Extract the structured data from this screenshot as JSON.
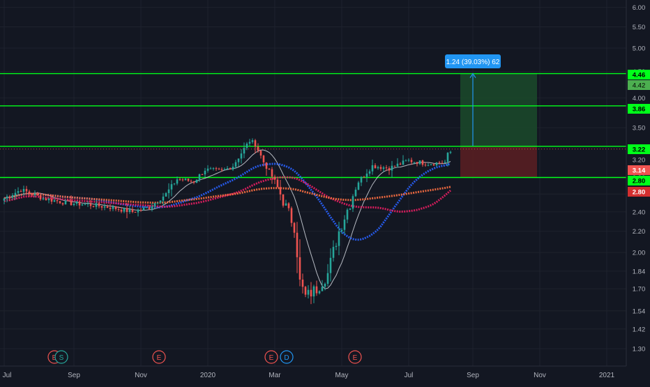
{
  "colors": {
    "background": "#131722",
    "grid": "#1e222d",
    "axis_text": "#b2b5be",
    "up": "#26a69a",
    "down": "#ef5350",
    "level_line": "#00ff1a",
    "profit_zone": "#1b4a2a",
    "loss_zone": "#5c1e22",
    "ma_fast": "#e0e3eb",
    "ma_mid": "#2962ff",
    "ma_slow": "#e91e63",
    "ma_long": "#ff7043",
    "measure": "#2196f3",
    "dotted_line": "#ff5252",
    "event_earnings": "#ef5350",
    "event_dividend": "#2196f3",
    "event_split": "#26a69a"
  },
  "chart_data": {
    "type": "candlestick",
    "x_axis_labels": [
      "Jul",
      "Sep",
      "Nov",
      "2020",
      "Mar",
      "May",
      "Jul",
      "Sep",
      "Nov",
      "2021"
    ],
    "y_axis_labels": [
      "6.00",
      "5.50",
      "5.00",
      "4.50",
      "4.00",
      "3.50",
      "2.80",
      "2.60",
      "2.40",
      "2.20",
      "2.00",
      "1.84",
      "1.70",
      "1.54",
      "1.42",
      "1.30"
    ],
    "y_scale": "log",
    "ylim": [
      1.26,
      6.05
    ],
    "grid": true,
    "price_tags": [
      {
        "label": "4.46",
        "value": 4.46,
        "style": "line"
      },
      {
        "label": "4.42",
        "value": 4.42,
        "style": "zone"
      },
      {
        "label": "3.86",
        "value": 3.86,
        "style": "line"
      },
      {
        "label": "3.22",
        "value": 3.22,
        "style": "line"
      },
      {
        "label": "3.20",
        "value": 3.2,
        "style": "plain"
      },
      {
        "label": "3.14",
        "value": 3.14,
        "style": "down"
      },
      {
        "label": "2.80",
        "value": 2.8,
        "style": "line"
      },
      {
        "label": "2.80",
        "value": 2.8,
        "style": "down-dark"
      }
    ],
    "horizontal_levels": [
      4.46,
      3.86,
      3.22,
      2.8
    ],
    "position": {
      "entry": 3.22,
      "target": 4.46,
      "stop": 2.8,
      "measure_label": "1.24 (39.03%) 62"
    },
    "events": [
      {
        "label": "E",
        "kind": "earnings",
        "x_label": "Aug"
      },
      {
        "label": "S",
        "kind": "split",
        "x_label": "Aug"
      },
      {
        "label": "E",
        "kind": "earnings",
        "x_label": "Nov"
      },
      {
        "label": "E",
        "kind": "earnings",
        "x_label": "Feb"
      },
      {
        "label": "D",
        "kind": "dividend",
        "x_label": "Mar"
      },
      {
        "label": "E",
        "kind": "earnings",
        "x_label": "May"
      }
    ],
    "price_path": [
      [
        0,
        2.55
      ],
      [
        6,
        2.65
      ],
      [
        14,
        2.55
      ],
      [
        22,
        2.5
      ],
      [
        30,
        2.48
      ],
      [
        38,
        2.45
      ],
      [
        46,
        2.4
      ],
      [
        52,
        2.45
      ],
      [
        58,
        2.6
      ],
      [
        62,
        2.78
      ],
      [
        68,
        2.75
      ],
      [
        72,
        2.9
      ],
      [
        78,
        2.88
      ],
      [
        82,
        2.95
      ],
      [
        88,
        3.3
      ],
      [
        90,
        3.25
      ],
      [
        93,
        3.0
      ],
      [
        97,
        2.75
      ],
      [
        101,
        2.45
      ],
      [
        104,
        2.25
      ],
      [
        106,
        1.75
      ],
      [
        108,
        1.64
      ],
      [
        112,
        1.7
      ],
      [
        116,
        1.82
      ],
      [
        120,
        2.2
      ],
      [
        124,
        2.5
      ],
      [
        127,
        2.75
      ],
      [
        132,
        2.95
      ],
      [
        138,
        2.92
      ],
      [
        145,
        3.02
      ],
      [
        152,
        2.98
      ],
      [
        158,
        3.0
      ],
      [
        160,
        3.2
      ]
    ],
    "moving_averages": [
      {
        "key": "ma_fast",
        "period": 10,
        "offset": 1.0
      },
      {
        "key": "ma_mid",
        "period": 30,
        "offset": 1.0
      },
      {
        "key": "ma_slow",
        "period": 50,
        "offset": 0.988
      },
      {
        "key": "ma_long",
        "period": 110,
        "offset": 1.0
      }
    ]
  }
}
